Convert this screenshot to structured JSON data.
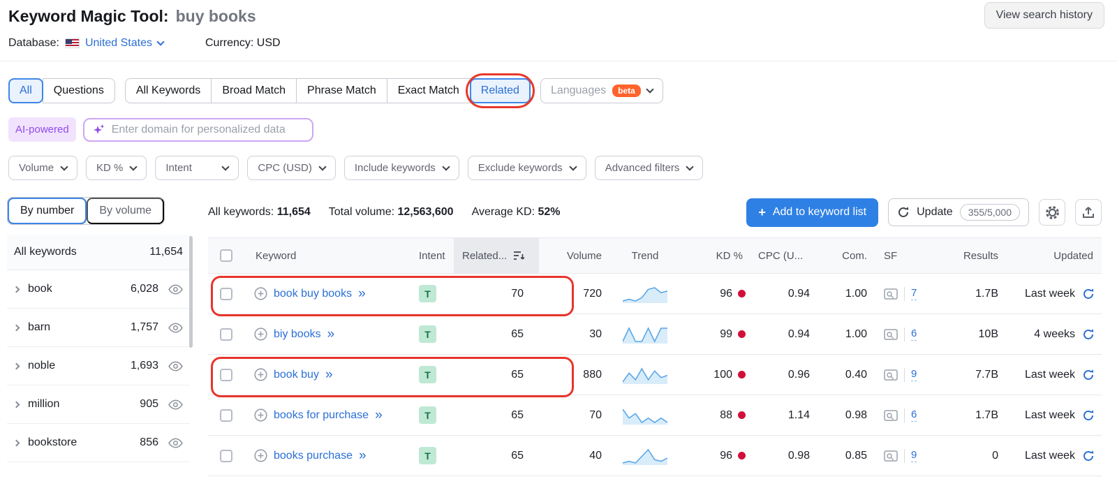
{
  "colors": {
    "link_blue": "#2a6fd6",
    "annotation_red": "#e8352b",
    "intent_green_bg": "#bfe9d4",
    "intent_green_text": "#15724c",
    "kd_red": "#d1103a",
    "ai_purple": "#9149ec",
    "beta_orange": "#ff642d",
    "primary_button_blue": "#2f80e4"
  },
  "header": {
    "title": "Keyword Magic Tool:",
    "query": "buy books",
    "view_search_history": "View search history",
    "database_label": "Database:",
    "database_value": "United States",
    "currency": "Currency: USD"
  },
  "tabs": {
    "group1": [
      {
        "label": "All",
        "selected": true
      },
      {
        "label": "Questions",
        "selected": false
      }
    ],
    "group2": [
      {
        "label": "All Keywords",
        "selected": false
      },
      {
        "label": "Broad Match",
        "selected": false
      },
      {
        "label": "Phrase Match",
        "selected": false
      },
      {
        "label": "Exact Match",
        "selected": false
      },
      {
        "label": "Related",
        "selected": true,
        "annotated": true
      }
    ],
    "languages": {
      "label": "Languages",
      "beta": "beta"
    }
  },
  "ai_bar": {
    "badge": "AI-powered",
    "placeholder": "Enter domain for personalized data"
  },
  "filters": [
    "Volume",
    "KD %",
    "Intent",
    "CPC (USD)",
    "Include keywords",
    "Exclude keywords",
    "Advanced filters"
  ],
  "sidebar": {
    "tabs": [
      {
        "label": "By number",
        "selected": true
      },
      {
        "label": "By volume",
        "selected": false
      }
    ],
    "all_row": {
      "label": "All keywords",
      "count": "11,654"
    },
    "items": [
      {
        "label": "book",
        "count": "6,028"
      },
      {
        "label": "barn",
        "count": "1,757"
      },
      {
        "label": "noble",
        "count": "1,693"
      },
      {
        "label": "million",
        "count": "905"
      },
      {
        "label": "bookstore",
        "count": "856"
      }
    ]
  },
  "summary": {
    "all_keywords_label": "All keywords:",
    "all_keywords_value": "11,654",
    "total_volume_label": "Total volume:",
    "total_volume_value": "12,563,600",
    "avg_kd_label": "Average KD:",
    "avg_kd_value": "52%",
    "add_button": "Add to keyword list",
    "update_button": "Update",
    "update_count": "355/5,000"
  },
  "table": {
    "headers": {
      "keyword": "Keyword",
      "intent": "Intent",
      "related": "Related...",
      "volume": "Volume",
      "trend": "Trend",
      "kd": "KD %",
      "cpc": "CPC (U...",
      "com": "Com.",
      "sf": "SF",
      "results": "Results",
      "updated": "Updated"
    },
    "rows": [
      {
        "keyword": "book buy books",
        "intent": "T",
        "related": "70",
        "volume": "720",
        "kd": "96",
        "cpc": "0.94",
        "com": "1.00",
        "sf": "7",
        "results": "1.7B",
        "updated": "Last week",
        "trend": [
          1,
          2,
          1,
          3,
          8,
          9,
          6,
          7
        ]
      },
      {
        "keyword": "biy books",
        "intent": "T",
        "related": "65",
        "volume": "30",
        "kd": "99",
        "cpc": "0.94",
        "com": "1.00",
        "sf": "6",
        "results": "10B",
        "updated": "4 weeks",
        "trend": [
          2,
          3,
          2,
          2,
          3,
          2,
          3,
          3
        ]
      },
      {
        "keyword": "book buy",
        "intent": "T",
        "related": "65",
        "volume": "880",
        "kd": "100",
        "cpc": "0.96",
        "com": "0.40",
        "sf": "9",
        "results": "7.7B",
        "updated": "Last week",
        "trend": [
          2,
          6,
          3,
          8,
          3,
          7,
          4,
          5
        ]
      },
      {
        "keyword": "books for purchase",
        "intent": "T",
        "related": "65",
        "volume": "70",
        "kd": "88",
        "cpc": "1.14",
        "com": "0.98",
        "sf": "6",
        "results": "1.7B",
        "updated": "Last week",
        "trend": [
          5,
          3,
          4,
          2,
          3,
          2,
          3,
          2
        ]
      },
      {
        "keyword": "books purchase",
        "intent": "T",
        "related": "65",
        "volume": "40",
        "kd": "96",
        "cpc": "0.98",
        "com": "0.85",
        "sf": "9",
        "results": "0",
        "updated": "Last week",
        "trend": [
          1,
          2,
          1,
          5,
          9,
          3,
          2,
          4
        ]
      }
    ]
  }
}
